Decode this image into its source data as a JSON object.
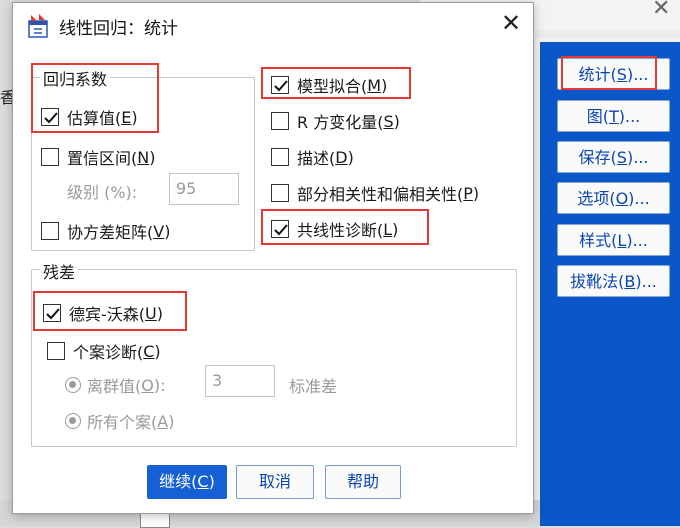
{
  "dialog": {
    "title": "线性回归：统计",
    "close_symbol": "✕"
  },
  "regression_coefficients": {
    "group_label": "回归系数",
    "estimates": {
      "pre": "估算值(",
      "key": "E",
      "post": ")",
      "checked": true
    },
    "confidence_intervals": {
      "pre": "置信区间(",
      "key": "N",
      "post": ")",
      "checked": false
    },
    "level_label": "级别 (%):",
    "level_value": "95",
    "covariance_matrix": {
      "pre": "协方差矩阵(",
      "key": "V",
      "post": ")",
      "checked": false
    }
  },
  "right_options": {
    "model_fit": {
      "pre": "模型拟合(",
      "key": "M",
      "post": ")",
      "checked": true
    },
    "r_squared_change": {
      "pre": "R 方变化量(",
      "key": "S",
      "post": ")",
      "checked": false
    },
    "descriptives": {
      "pre": "描述(",
      "key": "D",
      "post": ")",
      "checked": false
    },
    "part_partial": {
      "pre": "部分相关性和偏相关性(",
      "key": "P",
      "post": ")",
      "checked": false
    },
    "collinearity": {
      "pre": "共线性诊断(",
      "key": "L",
      "post": ")",
      "checked": true
    }
  },
  "residuals": {
    "group_label": "残差",
    "durbin_watson": {
      "pre": "德宾-沃森(",
      "key": "U",
      "post": ")",
      "checked": true
    },
    "casewise": {
      "pre": "个案诊断(",
      "key": "C",
      "post": ")",
      "checked": false
    },
    "outliers": {
      "pre": "离群值(",
      "key": "O",
      "post": "):",
      "selected": true
    },
    "outliers_value": "3",
    "outliers_unit": "标准差",
    "all_cases": {
      "pre": "所有个案(",
      "key": "A",
      "post": ")",
      "selected": false
    }
  },
  "buttons": {
    "continue": {
      "pre": "继续(",
      "key": "C",
      "post": ")"
    },
    "cancel": "取消",
    "help": "帮助"
  },
  "background": {
    "side_buttons": [
      {
        "pre": "统计(",
        "key": "S",
        "post": ")..."
      },
      {
        "pre": "图(",
        "key": "T",
        "post": ")..."
      },
      {
        "pre": "保存(",
        "key": "S",
        "post": ")..."
      },
      {
        "pre": "选项(",
        "key": "O",
        "post": ")..."
      },
      {
        "pre": "样式(",
        "key": "L",
        "post": ")..."
      },
      {
        "pre": "拔靴法(",
        "key": "B",
        "post": ")..."
      }
    ],
    "left_glyph": "香"
  },
  "colors": {
    "highlight": "#e53935",
    "accent_blue": "#1560d4",
    "link_text": "#0b46b0"
  }
}
